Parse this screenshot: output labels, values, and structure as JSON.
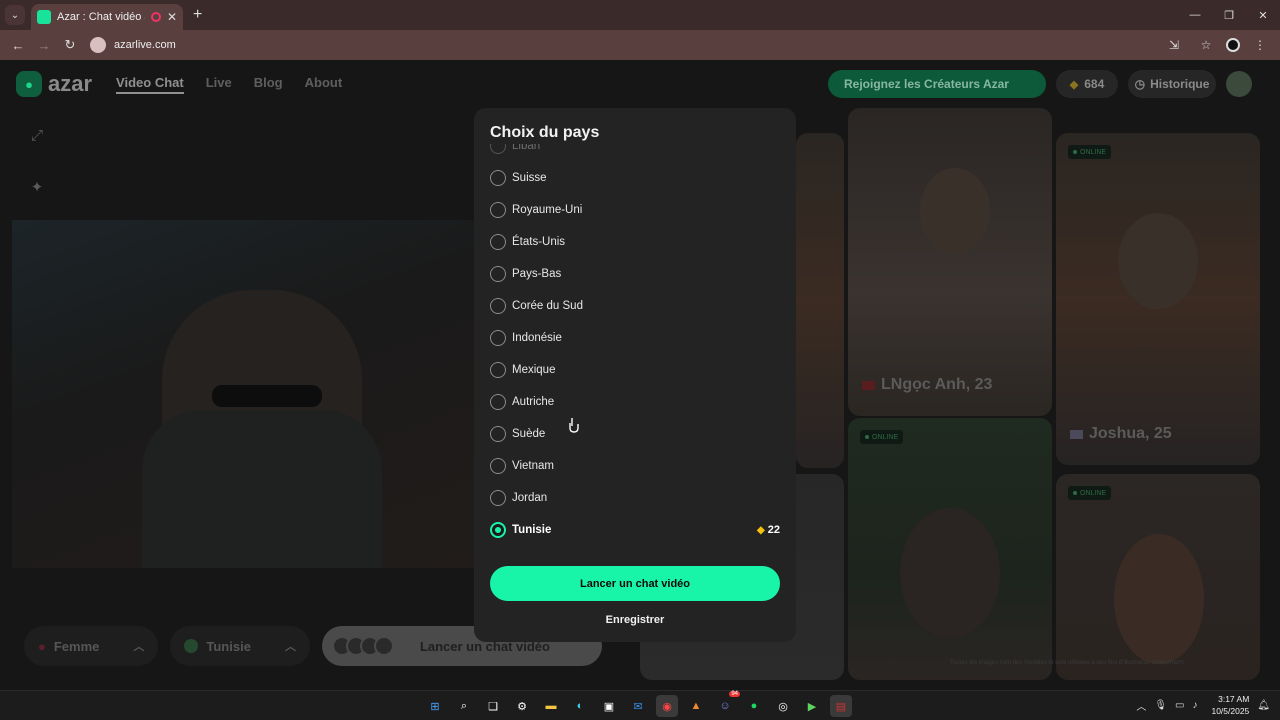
{
  "browser": {
    "tab_title": "Azar : Chat vidéo avec de n",
    "tab_close": "✕",
    "new_tab": "+",
    "url": "azarlive.com",
    "colors": {
      "accent": "#19f5a8",
      "tab_active": "#5a3f3f",
      "tabbar": "#3a2a2a"
    }
  },
  "site": {
    "logo_text": "azar",
    "nav": [
      {
        "label": "Video Chat",
        "active": true
      },
      {
        "label": "Live",
        "active": false
      },
      {
        "label": "Blog",
        "active": false
      },
      {
        "label": "About",
        "active": false
      }
    ],
    "creators_button": "Rejoignez les Créateurs Azar",
    "gems_count": "684",
    "history_button": "Historique",
    "gender_selector": "Femme",
    "country_selector": "Tunisie",
    "launch_button": "Lancer un chat vidéo",
    "tiles": [
      {
        "name": "LNgọc Anh, 23",
        "online_label": ""
      },
      {
        "name": "Joshua, 25",
        "online_label": "ONLINE"
      },
      {
        "name": "",
        "online_label": "ONLINE"
      },
      {
        "name": "",
        "online_label": "ONLINE"
      }
    ],
    "disclaimer": "Toutes les images sont des modèles et sont utilisées à des fins d'illustration uniquement."
  },
  "modal": {
    "title": "Choix du pays",
    "countries": [
      {
        "label": "Liban",
        "selected": false,
        "faded": true
      },
      {
        "label": "Suisse",
        "selected": false
      },
      {
        "label": "Royaume-Uni",
        "selected": false
      },
      {
        "label": "États-Unis",
        "selected": false
      },
      {
        "label": "Pays-Bas",
        "selected": false
      },
      {
        "label": "Corée du Sud",
        "selected": false
      },
      {
        "label": "Indonésie",
        "selected": false
      },
      {
        "label": "Mexique",
        "selected": false
      },
      {
        "label": "Autriche",
        "selected": false
      },
      {
        "label": "Suède",
        "selected": false
      },
      {
        "label": "Vietnam",
        "selected": false
      },
      {
        "label": "Jordan",
        "selected": false
      },
      {
        "label": "Tunisie",
        "selected": true,
        "price": "22"
      }
    ],
    "launch_button": "Lancer un chat vidéo",
    "save_button": "Enregistrer"
  },
  "taskbar": {
    "time": "3:17 AM",
    "date": "10/5/2025",
    "discord_badge": "94"
  }
}
